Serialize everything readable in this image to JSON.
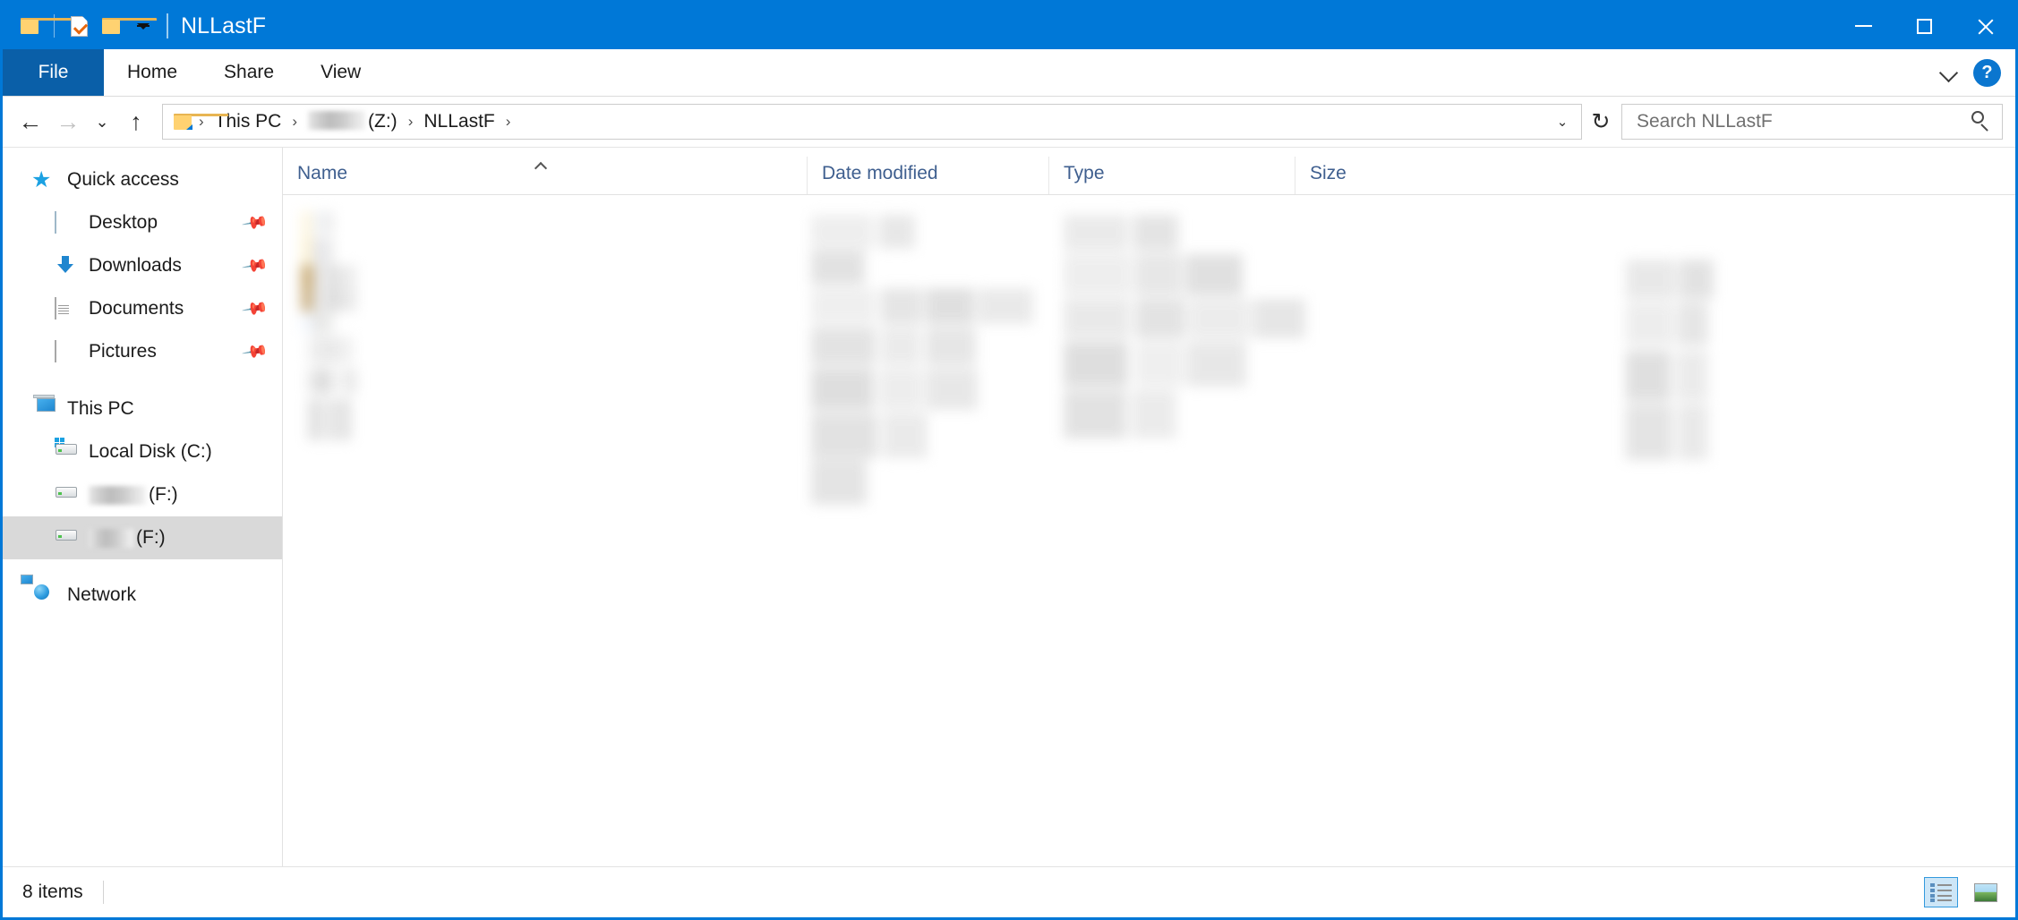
{
  "window": {
    "title": "NLLastF",
    "quick_access_toolbar": [
      {
        "name": "system-folder-icon",
        "label": "System menu"
      },
      {
        "name": "properties-icon",
        "label": "Properties"
      },
      {
        "name": "new-folder-icon",
        "label": "New folder"
      },
      {
        "name": "customize-qat-caret",
        "label": "Customize Quick Access Toolbar"
      }
    ],
    "controls": {
      "minimize": "Minimize",
      "maximize": "Maximize",
      "close": "Close"
    }
  },
  "ribbon": {
    "file_tab": "File",
    "tabs": [
      "Home",
      "Share",
      "View"
    ],
    "expand_label": "Expand the Ribbon",
    "help_label": "?"
  },
  "address": {
    "back_label": "Back",
    "forward_label": "Forward",
    "recent_label": "Recent locations",
    "up_label": "Up",
    "refresh_label": "Refresh",
    "breadcrumbs": [
      {
        "label": "",
        "type": "folder-icon"
      },
      {
        "label": "This PC",
        "type": "text"
      },
      {
        "label": "(Z:)",
        "type": "redacted-text"
      },
      {
        "label": "NLLastF",
        "type": "text"
      }
    ],
    "separator": "›",
    "dropdown_label": "Previous locations"
  },
  "search": {
    "placeholder": "Search NLLastF",
    "value": "",
    "icon": "search-icon"
  },
  "sidebar": {
    "groups": [
      {
        "name": "quick-access",
        "header": {
          "label": "Quick access",
          "icon": "star-icon"
        },
        "items": [
          {
            "label": "Desktop",
            "icon": "desktop-icon",
            "pinned": true
          },
          {
            "label": "Downloads",
            "icon": "download-icon",
            "pinned": true
          },
          {
            "label": "Documents",
            "icon": "document-icon",
            "pinned": true
          },
          {
            "label": "Pictures",
            "icon": "pictures-icon",
            "pinned": true
          }
        ]
      },
      {
        "name": "this-pc",
        "header": {
          "label": "This PC",
          "icon": "computer-icon"
        },
        "items": [
          {
            "label": "Local Disk (C:)",
            "icon": "windows-drive-icon",
            "selected": false,
            "redacted": false
          },
          {
            "label": "(F:)",
            "icon": "drive-icon",
            "selected": false,
            "redacted": true
          },
          {
            "label": "(F:)",
            "icon": "drive-icon",
            "selected": true,
            "redacted": true
          }
        ]
      },
      {
        "name": "network",
        "header": {
          "label": "Network",
          "icon": "network-icon"
        },
        "items": []
      }
    ]
  },
  "file_list": {
    "columns": [
      {
        "key": "name",
        "label": "Name",
        "sorted": true,
        "sort_direction": "ascending"
      },
      {
        "key": "date",
        "label": "Date modified",
        "sorted": false,
        "sort_direction": ""
      },
      {
        "key": "type",
        "label": "Type",
        "sorted": false,
        "sort_direction": ""
      },
      {
        "key": "size",
        "label": "Size",
        "sorted": false,
        "sort_direction": ""
      }
    ],
    "rows_redacted": true,
    "row_count": 8
  },
  "statusbar": {
    "item_count_text": "8 items",
    "views": [
      {
        "name": "details-view-button",
        "label": "Details",
        "active": true
      },
      {
        "name": "large-icons-view-button",
        "label": "Large icons",
        "active": false
      }
    ]
  },
  "colors": {
    "accent": "#0078d7",
    "file_tab": "#0a5fa8",
    "column_header_text": "#3f5f8f",
    "selection": "#d9d9d9"
  }
}
